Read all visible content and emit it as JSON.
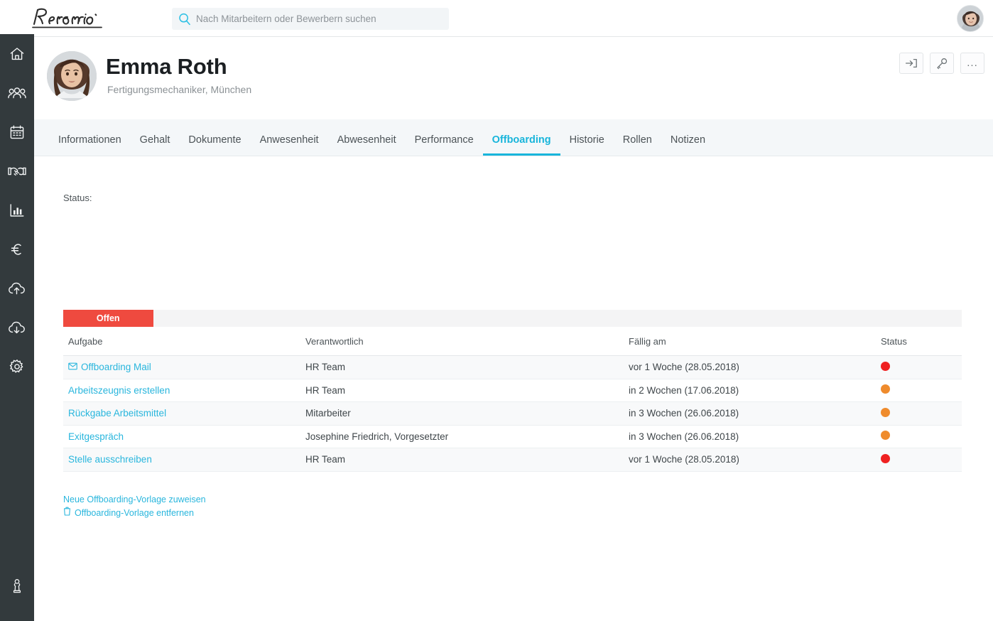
{
  "topbar": {
    "logo_text": "Personio",
    "search": {
      "placeholder": "Nach Mitarbeitern oder Bewerbern suchen",
      "value": "",
      "icon": "search-icon"
    },
    "user_avatar": "user-avatar"
  },
  "sidebar": {
    "items": [
      {
        "name": "home",
        "icon": "home-icon"
      },
      {
        "name": "employees",
        "icon": "people-icon"
      },
      {
        "name": "calendar",
        "icon": "calendar-icon"
      },
      {
        "name": "recruiting",
        "icon": "handshake-icon"
      },
      {
        "name": "reports",
        "icon": "bar-chart-icon"
      },
      {
        "name": "payroll",
        "icon": "euro-icon"
      },
      {
        "name": "import",
        "icon": "cloud-upload-icon"
      },
      {
        "name": "export",
        "icon": "cloud-download-icon"
      },
      {
        "name": "settings",
        "icon": "gear-icon"
      }
    ],
    "bottom_item": {
      "name": "account",
      "icon": "person-pawn-icon"
    }
  },
  "profile": {
    "name": "Emma Roth",
    "subtitle": "Fertigungsmechaniker, München",
    "avatar": "employee-avatar",
    "actions": [
      {
        "name": "login-as-employee",
        "icon": "sign-in-icon",
        "label": ""
      },
      {
        "name": "reset-password",
        "icon": "key-icon",
        "label": ""
      },
      {
        "name": "more-options",
        "icon": "ellipsis-icon",
        "label": "..."
      }
    ]
  },
  "tabs": [
    {
      "label": "Informationen",
      "active": false
    },
    {
      "label": "Gehalt",
      "active": false
    },
    {
      "label": "Dokumente",
      "active": false
    },
    {
      "label": "Anwesenheit",
      "active": false
    },
    {
      "label": "Abwesenheit",
      "active": false
    },
    {
      "label": "Performance",
      "active": false
    },
    {
      "label": "Offboarding",
      "active": true
    },
    {
      "label": "Historie",
      "active": false
    },
    {
      "label": "Rollen",
      "active": false
    },
    {
      "label": "Notizen",
      "active": false
    }
  ],
  "offboarding": {
    "status_label": "Status:",
    "progress": {
      "segment_label": "Offen",
      "segment_percent": 10,
      "fill_color": "#ef4a3f",
      "track_color": "#f4f4f5"
    },
    "columns": [
      "Aufgabe",
      "Verantwortlich",
      "Fällig am",
      "Status"
    ],
    "rows": [
      {
        "task": "Offboarding Mail",
        "task_icon": "envelope-icon",
        "responsible": "HR Team",
        "due": "vor 1 Woche (28.05.2018)",
        "status_color": "#ef2121"
      },
      {
        "task": "Arbeitszeugnis erstellen",
        "task_icon": "",
        "responsible": "HR Team",
        "due": "in 2 Wochen (17.06.2018)",
        "status_color": "#ef8b2c"
      },
      {
        "task": "Rückgabe Arbeitsmittel",
        "task_icon": "",
        "responsible": "Mitarbeiter",
        "due": "in 3 Wochen (26.06.2018)",
        "status_color": "#ef8b2c"
      },
      {
        "task": "Exitgespräch",
        "task_icon": "",
        "responsible": "Josephine Friedrich, Vorgesetzter",
        "due": "in 3 Wochen (26.06.2018)",
        "status_color": "#ef8b2c"
      },
      {
        "task": "Stelle ausschreiben",
        "task_icon": "",
        "responsible": "HR Team",
        "due": "vor 1 Woche (28.05.2018)",
        "status_color": "#ef2121"
      }
    ],
    "links": [
      {
        "label": "Neue Offboarding-Vorlage zuweisen",
        "icon": ""
      },
      {
        "label": "Offboarding-Vorlage entfernen",
        "icon": "trash-icon"
      }
    ]
  },
  "colors": {
    "accent": "#18b5db",
    "link": "#29b6dd",
    "rail_bg": "#333a3d",
    "tab_bg": "#f4f7f9",
    "danger": "#ef4a3f",
    "warning": "#ef8b2c"
  }
}
